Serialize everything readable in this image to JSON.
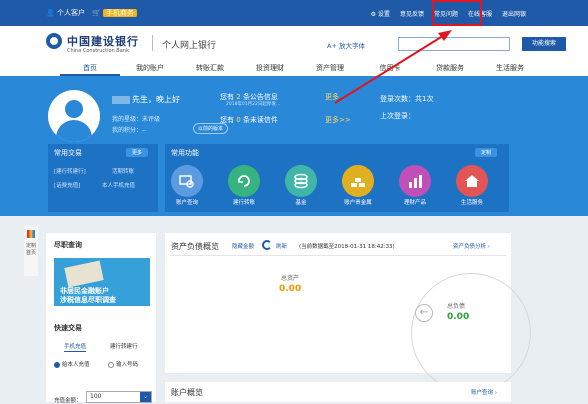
{
  "topbar": {
    "user": "个人客户",
    "cart_icon": "cart-icon",
    "cart_badge": "手机商务",
    "links": [
      "设置",
      "意见反馈",
      "常见问题",
      "在线客服",
      "退出网银"
    ]
  },
  "header": {
    "logo_cn": "中国建设银行",
    "logo_en": "China Construction Bank",
    "subtitle": "个人网上银行",
    "font_link": "A+ 放大字体",
    "search_placeholder": "",
    "search_button": "功能搜索"
  },
  "nav": {
    "items": [
      "首页",
      "我的账户",
      "转账汇款",
      "投资理财",
      "资产管理",
      "信用卡",
      "贷款服务",
      "生活服务"
    ]
  },
  "profile": {
    "greeting": "先生，晚上好",
    "rating": "我的星级：未评级",
    "points": "我的积分：--",
    "pill": "以前的版本"
  },
  "messages": {
    "line1_pre": "您有",
    "line1_count": "2",
    "line1_post": "条公告信息",
    "line1_more": "更多",
    "line1_small": "2018年01月22日起停发...",
    "line2_pre": "您有",
    "line2_count": "0",
    "line2_post": "条未读信件",
    "line2_more": "更多>>"
  },
  "login": {
    "count": "登录次数：共1次",
    "last": "上次登录："
  },
  "quick_panel": {
    "title": "常用交易",
    "button": "更多",
    "items": [
      "[建行转建行]",
      "活期转账",
      "[话费充值]",
      "本人手机充值"
    ]
  },
  "func_panel": {
    "title": "常用功能",
    "button": "定制",
    "items": [
      {
        "label": "账户查询",
        "icon": "search-card-icon",
        "color": "#5b9be0"
      },
      {
        "label": "建行转账",
        "icon": "transfer-icon",
        "color": "#36b37e"
      },
      {
        "label": "基金",
        "icon": "fund-icon",
        "color": "#3fb6a8"
      },
      {
        "label": "账户贵金属",
        "icon": "gold-icon",
        "color": "#e0b020"
      },
      {
        "label": "理财产品",
        "icon": "finance-icon",
        "color": "#c04fb8"
      },
      {
        "label": "生活服务",
        "icon": "home-icon",
        "color": "#e35454"
      }
    ]
  },
  "side_strip": {
    "label": "定制首页"
  },
  "left": {
    "title": "尽职查询",
    "ad_line1": "非居民金融账户",
    "ad_line2": "涉税信息尽职调查",
    "quick_title": "快速交易",
    "tab1": "手机充值",
    "tab2": "建行转建行",
    "radio1": "给本人充值",
    "radio2": "输入号码",
    "amount_label": "充值金额：",
    "amount_value": "100"
  },
  "assets": {
    "title": "资产负债概览",
    "hide": "隐藏金额",
    "refresh": "刷新",
    "date": "(当前数据截至2018-01-31 18:42:33)",
    "link": "资产负债分析 ›",
    "total_assets_label": "总资产",
    "total_assets_value": "0.00",
    "total_liab_label": "总负债",
    "total_liab_value": "0.00"
  },
  "overview": {
    "title": "账户概览",
    "link": "账户查询 ›"
  },
  "colors": {
    "brand": "#1f5aa8",
    "banner": "#2a88d8",
    "highlight": "#e0161e",
    "asset_value": "#f39800",
    "liability_value": "#2aa13a"
  }
}
